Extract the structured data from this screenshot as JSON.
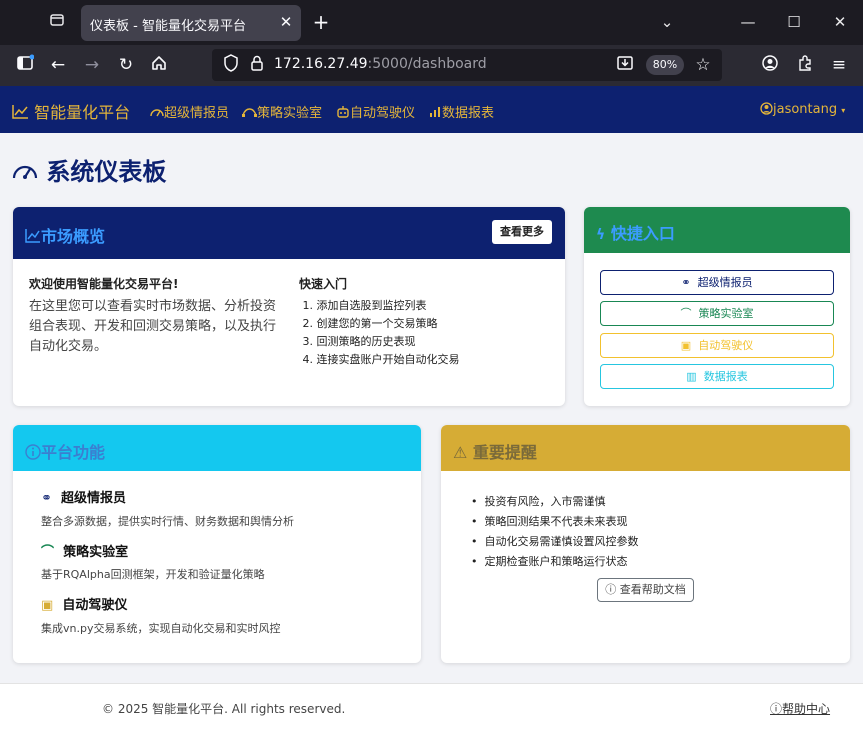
{
  "browser": {
    "tab_title": "仪表板 - 智能量化交易平台",
    "url_host": "172.16.27.49",
    "url_rest": ":5000/dashboard",
    "zoom": "80%"
  },
  "nav": {
    "brand": "智能量化平台",
    "links": [
      "超级情报员",
      "策略实验室",
      "自动驾驶仪",
      "数据报表"
    ],
    "user": "jasontang"
  },
  "page": {
    "title": "系统仪表板"
  },
  "market": {
    "title": "市场概览",
    "more_button": "查看更多",
    "welcome_title": "欢迎使用智能量化交易平台!",
    "welcome_text": "在这里您可以查看实时市场数据、分析投资组合表现、开发和回测交易策略，以及执行自动化交易。",
    "quick_title": "快速入门",
    "quick_steps": [
      "添加自选股到监控列表",
      "创建您的第一个交易策略",
      "回测策略的历史表现",
      "连接实盘账户开始自动化交易"
    ]
  },
  "shortcuts": {
    "title": "快捷入口",
    "buttons": [
      "超级情报员",
      "策略实验室",
      "自动驾驶仪",
      "数据报表"
    ]
  },
  "features": {
    "title": "平台功能",
    "items": [
      {
        "title": "超级情报员",
        "desc": "整合多源数据，提供实时行情、财务数据和舆情分析"
      },
      {
        "title": "策略实验室",
        "desc": "基于RQAlpha回测框架，开发和验证量化策略"
      },
      {
        "title": "自动驾驶仪",
        "desc": "集成vn.py交易系统，实现自动化交易和实时风控"
      }
    ]
  },
  "notice": {
    "title": "重要提醒",
    "items": [
      "投资有风险，入市需谨慎",
      "策略回测结果不代表未来表现",
      "自动化交易需谨慎设置风控参数",
      "定期检查账户和策略运行状态"
    ],
    "help_button": "查看帮助文档"
  },
  "footer": {
    "copyright": "© 2025 智能量化平台. All rights reserved.",
    "help": "帮助中心"
  },
  "colors": {
    "navy": "#0d2170",
    "gold": "#e4b53a",
    "green": "#1e8a4f",
    "cyan": "#14c8ef",
    "warning": "#d6ac35",
    "shortcut_green": "#198754",
    "shortcut_yellow": "#f2c12e",
    "shortcut_cyan": "#26c6e0"
  }
}
